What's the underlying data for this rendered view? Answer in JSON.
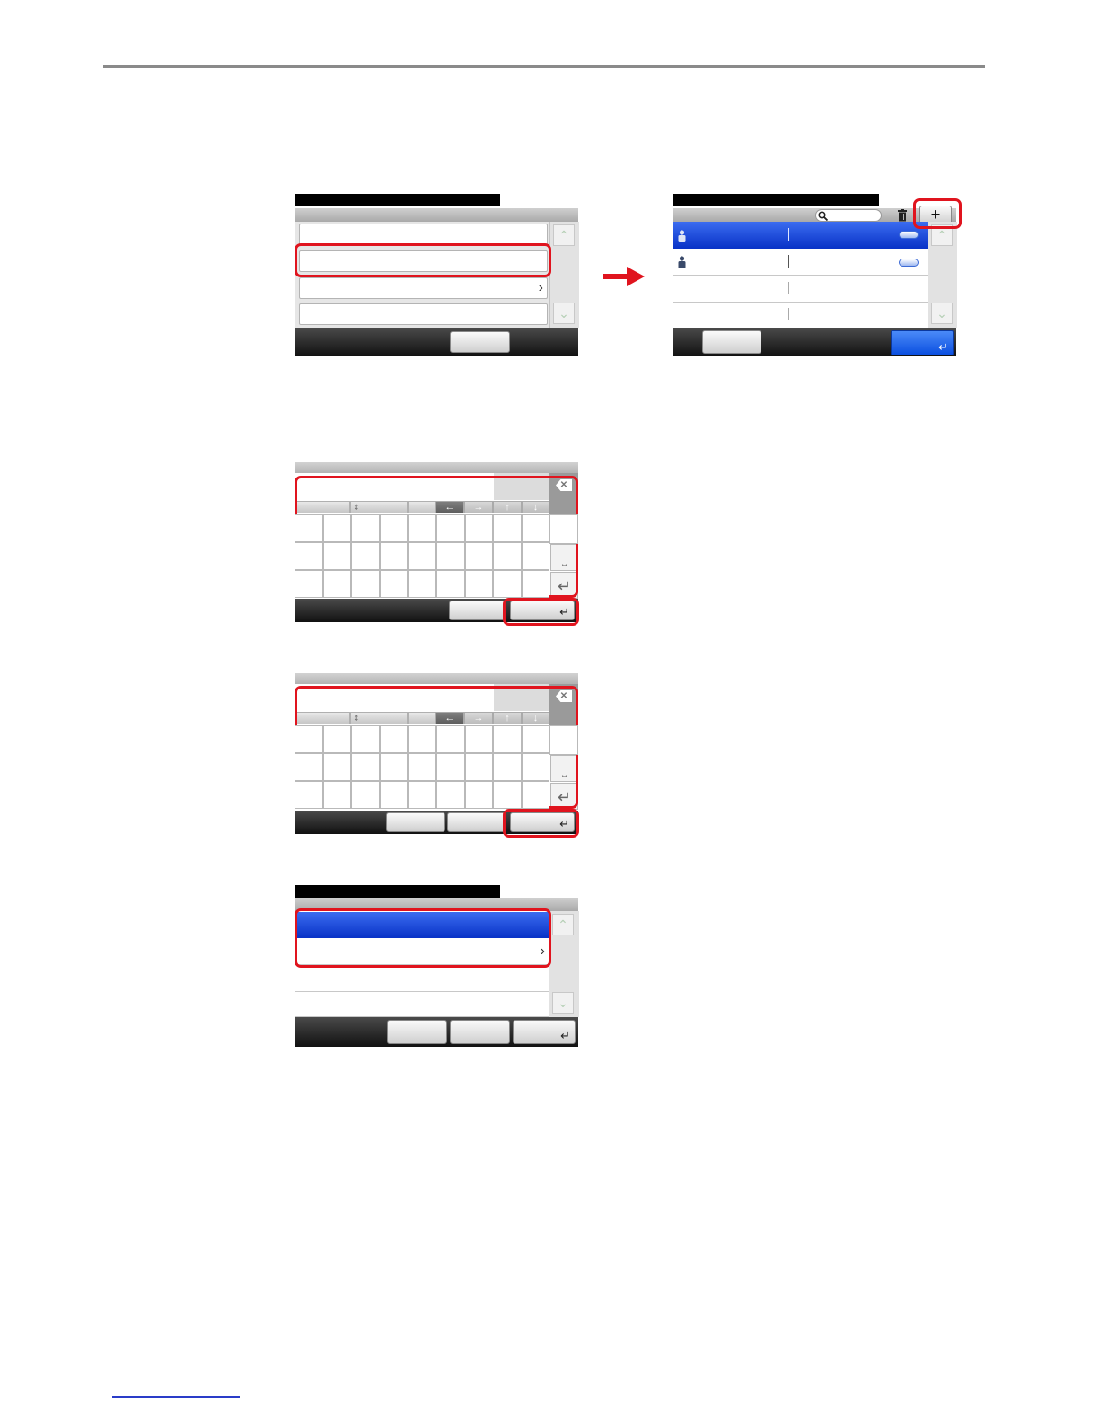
{
  "page": {
    "rule_color": "#8a8a8a",
    "highlight_color": "#e0141e",
    "selected_row_color": "#0a34c8"
  },
  "icons": {
    "arrow": "right-arrow-icon",
    "search": "search-icon",
    "trash": "trash-icon",
    "add": "plus-icon",
    "user": "user-icon",
    "backspace": "backspace-icon",
    "enter": "enter-icon",
    "space": "space-icon",
    "chevron": "chevron-right-icon",
    "scroll_up": "chevron-up-icon",
    "scroll_down": "chevron-down-icon"
  },
  "panel_add": {
    "add_glyph": "+"
  },
  "glyphs": {
    "chevron_right": "›",
    "enter": "↵",
    "space": "⎵",
    "left": "←",
    "right": "→",
    "up": "↑",
    "down": "↓",
    "up_scroll": "⌃",
    "down_scroll": "⌄",
    "backspace": "✕",
    "updown": "⇕"
  }
}
